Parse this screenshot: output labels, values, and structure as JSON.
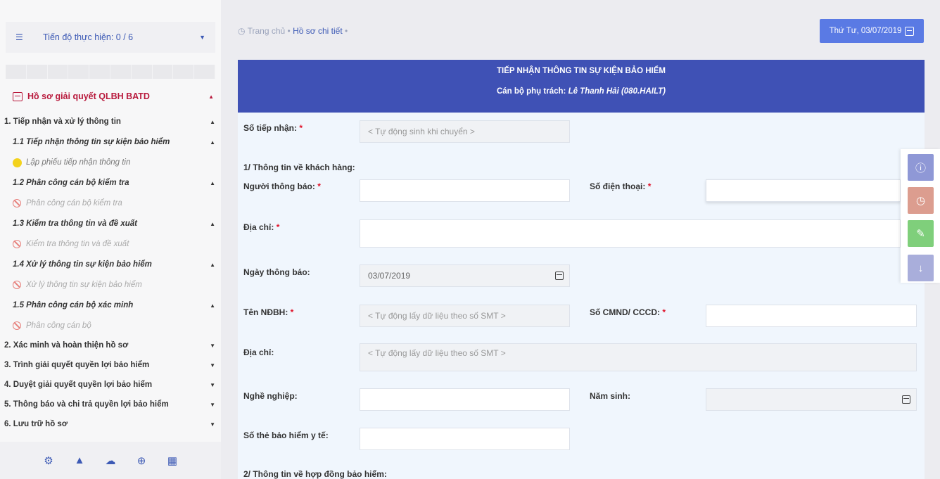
{
  "sidebar": {
    "progress_label": "Tiến độ thực hiện: 0 / 6",
    "case_title": "Hồ sơ giải quyết QLBH BATD",
    "tree": [
      {
        "label": "1. Tiếp nhận và xử lý thông tin",
        "level": 1,
        "state": "open"
      },
      {
        "label": "1.1 Tiếp nhận thông tin sự kiện bảo hiểm",
        "level": 2,
        "state": "open"
      },
      {
        "label": "Lập phiếu tiếp nhận thông tin",
        "level": 3,
        "status": "in-progress"
      },
      {
        "label": "1.2 Phân công cán bộ kiểm tra",
        "level": 2,
        "state": "open"
      },
      {
        "label": "Phân công cán bộ kiểm tra",
        "level": 3,
        "status": "blocked"
      },
      {
        "label": "1.3 Kiểm tra thông tin và đề xuất",
        "level": 2,
        "state": "open"
      },
      {
        "label": "Kiểm tra thông tin và đề xuất",
        "level": 3,
        "status": "blocked"
      },
      {
        "label": "1.4 Xử lý thông tin sự kiện bảo hiểm",
        "level": 2,
        "state": "open"
      },
      {
        "label": "Xử lý thông tin sự kiện bảo hiểm",
        "level": 3,
        "status": "blocked"
      },
      {
        "label": "1.5 Phân công cán bộ xác minh",
        "level": 2,
        "state": "open"
      },
      {
        "label": "Phân công cán bộ",
        "level": 3,
        "status": "blocked"
      },
      {
        "label": "2. Xác minh và hoàn thiện hồ sơ",
        "level": 1,
        "state": "closed"
      },
      {
        "label": "3. Trình giải quyết quyền lợi bảo hiểm",
        "level": 1,
        "state": "closed"
      },
      {
        "label": "4. Duyệt giải quyết quyền lợi bảo hiểm",
        "level": 1,
        "state": "closed"
      },
      {
        "label": "5. Thông báo và chi trả quyền lợi bảo hiểm",
        "level": 1,
        "state": "closed"
      },
      {
        "label": "6. Lưu trữ hồ sơ",
        "level": 1,
        "state": "closed"
      }
    ],
    "footer_icons": [
      "gear-icon",
      "bell-icon",
      "cloud-icon",
      "plus-circle-icon",
      "calendar-icon"
    ]
  },
  "breadcrumb": {
    "home": "Trang chủ",
    "current": "Hồ sơ chi tiết"
  },
  "date_button": "Thứ Tư, 03/07/2019",
  "form": {
    "header_title": "TIẾP NHẬN THÔNG TIN SỰ KIỆN BẢO HIỂM",
    "officer_prefix": "Cán bộ phụ trách: ",
    "officer_name": "Lê Thanh Hải (080.HAILT)",
    "receipt_no_label": "Số tiếp nhận:",
    "receipt_no_placeholder": "< Tự động sinh khi chuyển >",
    "section1": "1/ Thông tin về khách hàng:",
    "notifier_label": "Người thông báo:",
    "phone_label": "Số điện thoại:",
    "address_label": "Địa chỉ:",
    "notify_date_label": "Ngày thông báo:",
    "notify_date_value": "03/07/2019",
    "insured_name_label": "Tên NĐBH:",
    "insured_name_placeholder": "< Tự động lấy dữ liệu theo số SMT >",
    "id_label": "Số CMND/ CCCD:",
    "address2_label": "Địa chỉ:",
    "address2_placeholder": "< Tự động lấy dữ liệu theo số SMT >",
    "job_label": "Nghề nghiệp:",
    "birth_year_label": "Năm sinh:",
    "health_card_label": "Số thẻ bảo hiểm y tế:",
    "section2": "2/ Thông tin về hợp đồng bảo hiểm:",
    "required_mark": "*"
  },
  "side_buttons": [
    {
      "icon": "info-icon",
      "color": "#8f98d6"
    },
    {
      "icon": "clock-icon",
      "color": "#dc9d8f"
    },
    {
      "icon": "edit-doc-icon",
      "color": "#7fcf7b"
    },
    {
      "icon": "arrow-down-icon",
      "color": "#a9aedb"
    }
  ]
}
